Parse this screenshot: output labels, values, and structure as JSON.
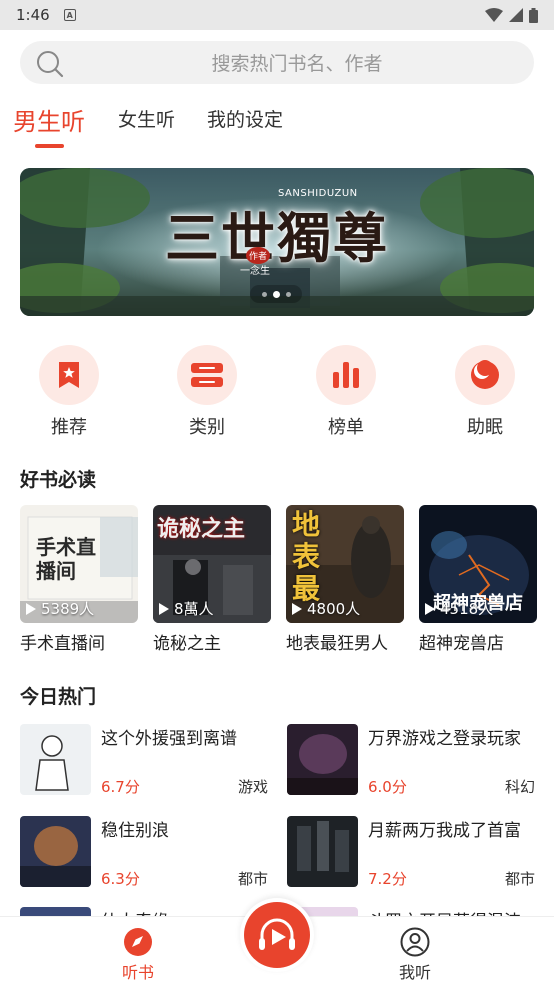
{
  "status_bar": {
    "time": "1:46",
    "notif_letter": "A"
  },
  "search": {
    "placeholder": "搜索热门书名、作者"
  },
  "tabs": [
    {
      "label": "男生听",
      "active": true
    },
    {
      "label": "女生听",
      "active": false
    },
    {
      "label": "我的设定",
      "active": false
    }
  ],
  "banner": {
    "title": "三世獨尊",
    "subtitle": "SANSHIDUZUN",
    "author_tag": "作者",
    "author": "一念生",
    "dots": 3,
    "active_dot": 2
  },
  "categories": [
    {
      "label": "推荐",
      "icon": "bookmark-star-icon"
    },
    {
      "label": "类别",
      "icon": "category-list-icon"
    },
    {
      "label": "榜单",
      "icon": "bar-chart-icon"
    },
    {
      "label": "助眠",
      "icon": "moon-sleep-icon"
    }
  ],
  "sections": {
    "must_read": "好书必读",
    "today_hot": "今日热门"
  },
  "must_read_books": [
    {
      "name": "手术直播间",
      "listeners": "5389人",
      "cover_text": "手术直播间"
    },
    {
      "name": "诡秘之主",
      "listeners": "8萬人",
      "cover_text": "诡秘之主"
    },
    {
      "name": "地表最狂男人",
      "listeners": "4800人",
      "cover_text": "地表最"
    },
    {
      "name": "超神宠兽店",
      "listeners": "4518人",
      "cover_text": "超神宠兽店"
    }
  ],
  "hot_books": [
    {
      "title": "这个外援强到离谱",
      "score": "6.7分",
      "genre": "游戏"
    },
    {
      "title": "万界游戏之登录玩家",
      "score": "6.0分",
      "genre": "科幻"
    },
    {
      "title": "稳住别浪",
      "score": "6.3分",
      "genre": "都市"
    },
    {
      "title": "月薪两万我成了首富",
      "score": "7.2分",
      "genre": "都市"
    },
    {
      "title": "仙大奇缘",
      "score": "",
      "genre": ""
    },
    {
      "title": "斗罗之开局获得混沌",
      "score": "",
      "genre": ""
    }
  ],
  "bottom_nav": {
    "listen": "听书",
    "mine": "我听"
  },
  "colors": {
    "accent": "#e8442d",
    "accent_light": "#fde9e4"
  }
}
